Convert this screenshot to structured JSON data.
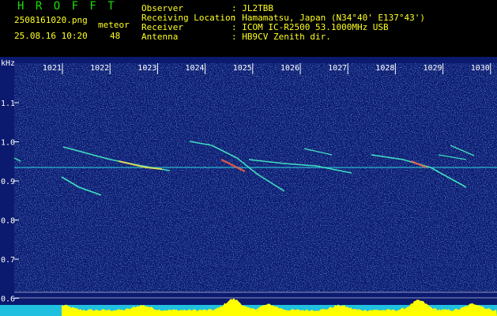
{
  "header": {
    "app_title": "H R O F F T",
    "filename": "2508161020.png",
    "datetime": "25.08.16 10:20",
    "meteor_label": "meteor",
    "meteor_count": "48"
  },
  "info": {
    "labels": [
      "Observer",
      "Receiving Location",
      "Receiver",
      "Antenna"
    ],
    "values": [
      ": JL2TBB",
      ": Hamamatsu, Japan (N34°40' E137°43')",
      ": ICOM IC-R2500 53.1000MHz USB",
      ": HB9CV Zenith dir."
    ]
  },
  "plot": {
    "y_unit": "kHz",
    "y_ticks": [
      "1.1",
      "1.0",
      "0.9",
      "0.8",
      "0.7",
      "0.6"
    ],
    "x_ticks": [
      "1021",
      "1022",
      "1023",
      "1024",
      "1025",
      "1026",
      "1027",
      "1028",
      "1029",
      "1030"
    ]
  },
  "colors": {
    "background": "#0b1a6e",
    "header_text": "#ffff20",
    "title_text": "#18e000",
    "noise_bar": "#ffff00",
    "trace": "#40e0d0"
  }
}
